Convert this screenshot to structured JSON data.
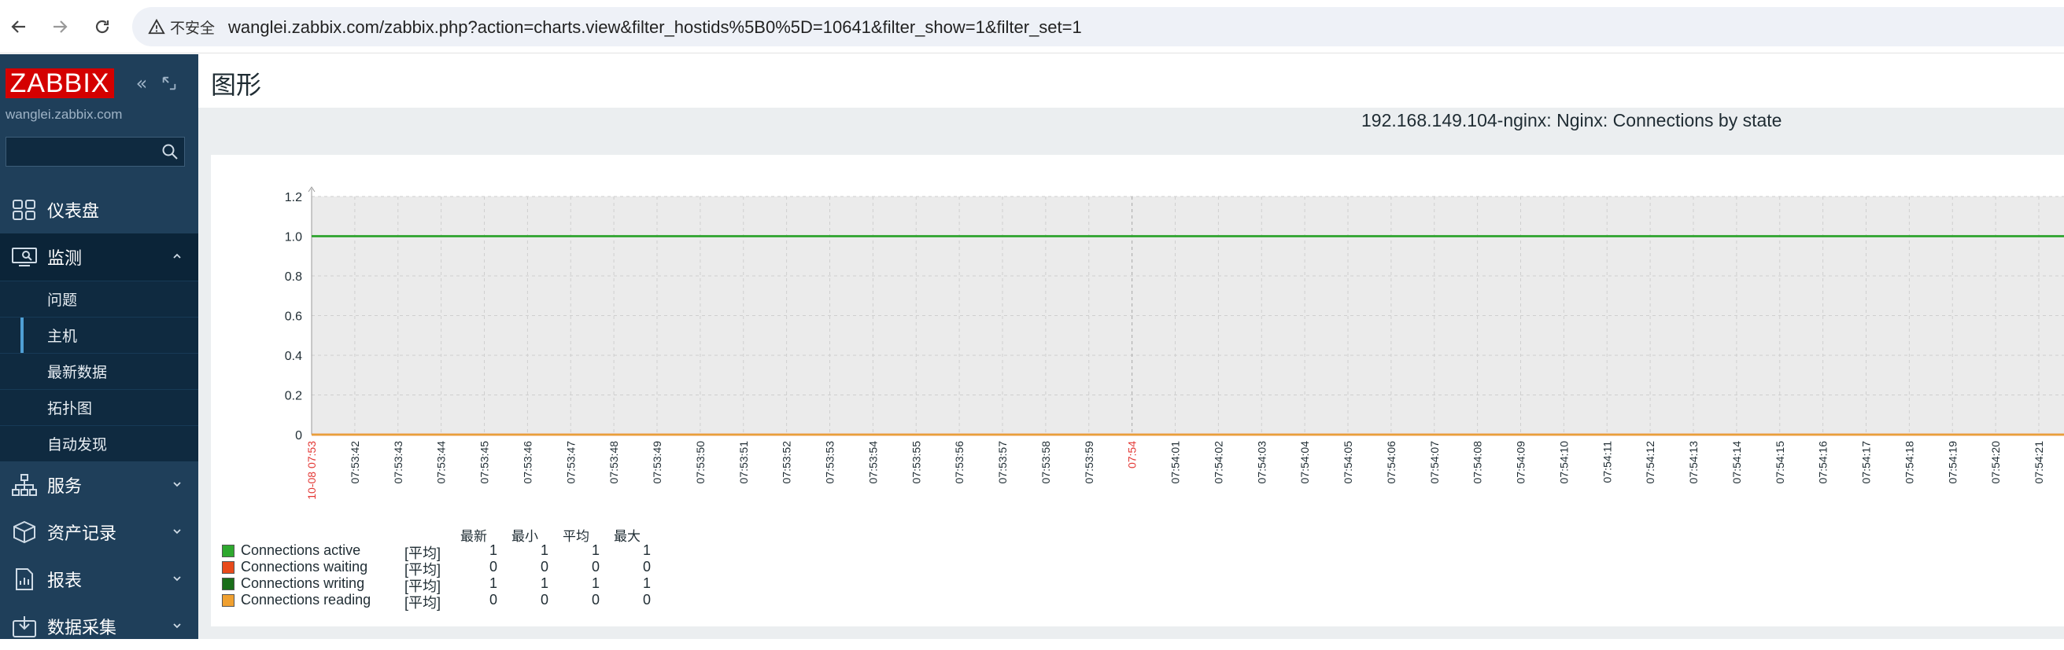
{
  "browser": {
    "insecure_label": "不安全",
    "url": "wanglei.zabbix.com/zabbix.php?action=charts.view&filter_hostids%5B0%5D=10641&filter_show=1&filter_set=1"
  },
  "sidebar": {
    "logo": "ZABBIX",
    "server_name": "wanglei.zabbix.com",
    "search_placeholder": "",
    "items": [
      {
        "label": "仪表盘",
        "icon": "dashboard-icon"
      },
      {
        "label": "监测",
        "icon": "monitoring-icon",
        "expanded": true,
        "children": [
          "问题",
          "主机",
          "最新数据",
          "拓扑图",
          "自动发现"
        ],
        "selected_child": "主机"
      },
      {
        "label": "服务",
        "icon": "services-icon"
      },
      {
        "label": "资产记录",
        "icon": "inventory-icon"
      },
      {
        "label": "报表",
        "icon": "reports-icon"
      },
      {
        "label": "数据采集",
        "icon": "data-collection-icon"
      }
    ]
  },
  "page": {
    "title": "图形"
  },
  "chart_data": {
    "type": "line",
    "title": "192.168.149.104-nginx: Nginx: Connections by state",
    "x": [
      "10-08 07:53",
      "07:53:42",
      "07:53:43",
      "07:53:44",
      "07:53:45",
      "07:53:46",
      "07:53:47",
      "07:53:48",
      "07:53:49",
      "07:53:50",
      "07:53:51",
      "07:53:52",
      "07:53:53",
      "07:53:54",
      "07:53:55",
      "07:53:56",
      "07:53:57",
      "07:53:58",
      "07:53:59",
      "07:54",
      "07:54:01",
      "07:54:02",
      "07:54:03",
      "07:54:04",
      "07:54:05",
      "07:54:06",
      "07:54:07",
      "07:54:08",
      "07:54:09",
      "07:54:10",
      "07:54:11",
      "07:54:12",
      "07:54:13",
      "07:54:14",
      "07:54:15",
      "07:54:16",
      "07:54:17",
      "07:54:18",
      "07:54:19",
      "07:54:20",
      "07:54:21"
    ],
    "highlight_ticks": [
      "10-08 07:53",
      "07:54"
    ],
    "y_ticks": [
      "0",
      "0.2",
      "0.4",
      "0.6",
      "0.8",
      "1.0",
      "1.2"
    ],
    "ylim": [
      0,
      1.2
    ],
    "grid": true,
    "legend_position": "bottom-left",
    "legend_headers": [
      "最新",
      "最小",
      "平均",
      "最大"
    ],
    "series": [
      {
        "name": "Connections active",
        "function": "[平均]",
        "color": "#2ea82e",
        "values": [
          1
        ],
        "stats": [
          "1",
          "1",
          "1",
          "1"
        ]
      },
      {
        "name": "Connections waiting",
        "function": "[平均]",
        "color": "#e84a1b",
        "values": [
          0
        ],
        "stats": [
          "0",
          "0",
          "0",
          "0"
        ]
      },
      {
        "name": "Connections writing",
        "function": "[平均]",
        "color": "#1a6e1a",
        "values": [
          1
        ],
        "stats": [
          "1",
          "1",
          "1",
          "1"
        ]
      },
      {
        "name": "Connections reading",
        "function": "[平均]",
        "color": "#f0a030",
        "values": [
          0
        ],
        "stats": [
          "0",
          "0",
          "0",
          "0"
        ]
      }
    ]
  }
}
